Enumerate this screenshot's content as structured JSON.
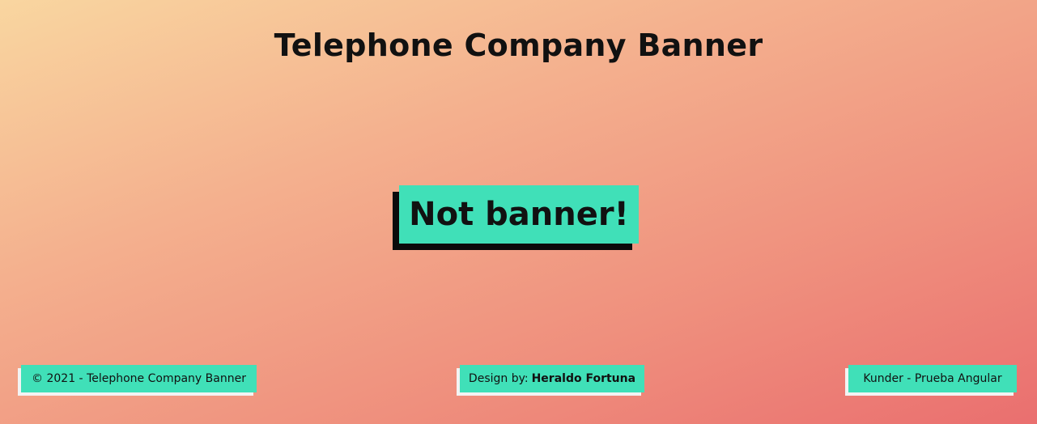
{
  "header": {
    "title": "Telephone Company Banner"
  },
  "banner": {
    "text": "Not banner!"
  },
  "footer": {
    "copyright": "© 2021 - Telephone Company Banner",
    "design_label": "Design by:",
    "designer": "Heraldo Fortuna",
    "project": "Kunder - Prueba Angular"
  },
  "colors": {
    "accent": "#40e0b8",
    "shadow": "#0b0b0b",
    "gradient_start": "#f9d6a0",
    "gradient_end": "#ea6f6f"
  }
}
